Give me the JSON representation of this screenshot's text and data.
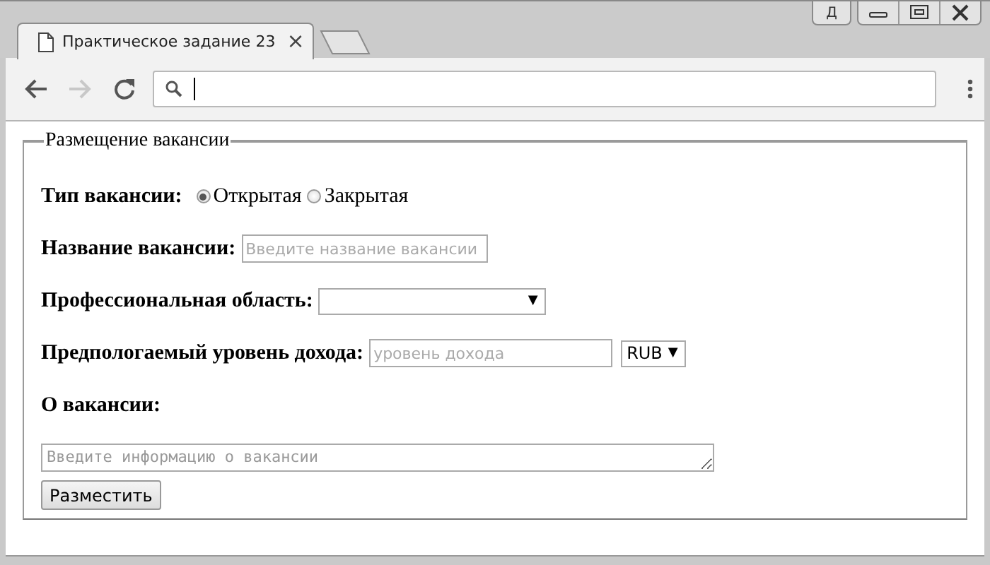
{
  "window": {
    "profile_badge": "Д",
    "tab": {
      "title": "Практическое задание 23",
      "close": "×"
    }
  },
  "form": {
    "legend": "Размещение вакансии",
    "vacancy_type": {
      "label": "Тип вакансии:",
      "options": [
        {
          "label": "Открытая",
          "selected": true
        },
        {
          "label": "Закрытая",
          "selected": false
        }
      ]
    },
    "title": {
      "label": "Название вакансии:",
      "placeholder": "Введите название вакансии"
    },
    "area": {
      "label": "Профессиональная область:",
      "arrow": "▼"
    },
    "income": {
      "label": "Предпологаемый уровень дохода:",
      "placeholder": "уровень дохода",
      "currency": "RUB",
      "arrow": "▼"
    },
    "about": {
      "label": "О вакансии:",
      "placeholder": "Введите информацию о вакансии"
    },
    "submit": "Разместить"
  }
}
